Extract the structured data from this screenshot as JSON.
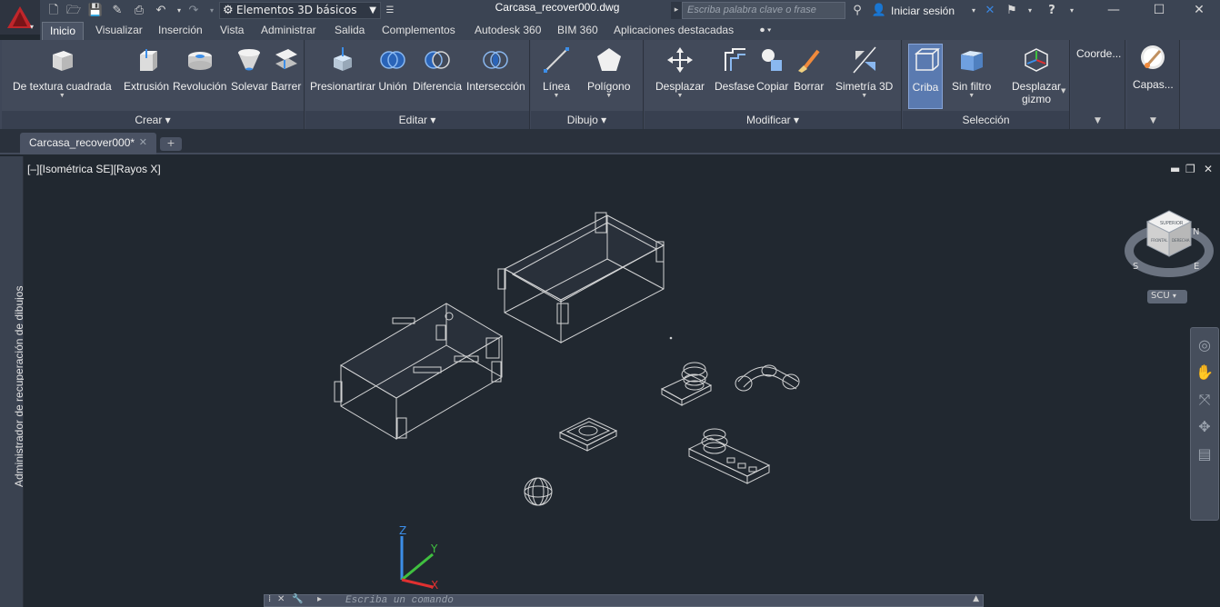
{
  "titlebar": {
    "workspace": "Elementos 3D básicos",
    "file_title": "Carcasa_recover000.dwg",
    "search_placeholder": "Escriba palabra clave o frase",
    "signin": "Iniciar sesión"
  },
  "tabs": [
    {
      "label": "Inicio",
      "active": true
    },
    {
      "label": "Visualizar"
    },
    {
      "label": "Inserción"
    },
    {
      "label": "Vista"
    },
    {
      "label": "Administrar"
    },
    {
      "label": "Salida"
    },
    {
      "label": "Complementos"
    },
    {
      "label": "Autodesk 360"
    },
    {
      "label": "BIM 360"
    },
    {
      "label": "Aplicaciones destacadas"
    }
  ],
  "panels": {
    "crear": {
      "title": "Crear",
      "tools": [
        "De textura cuadrada",
        "Extrusión",
        "Revolución",
        "Solevar",
        "Barrer"
      ]
    },
    "editar": {
      "title": "Editar",
      "tools": [
        "Presionartirar",
        "Unión",
        "Diferencia",
        "Intersección"
      ]
    },
    "dibujo": {
      "title": "Dibujo",
      "tools": [
        "Línea",
        "Polígono"
      ]
    },
    "modificar": {
      "title": "Modificar",
      "tools": [
        "Desplazar",
        "Desfase",
        "Copiar",
        "Borrar",
        "Simetría 3D"
      ]
    },
    "seleccion": {
      "title": "Selección",
      "tools": [
        "Criba",
        "Sin filtro",
        "Desplazar",
        "gizmo"
      ]
    },
    "coords": {
      "title": "Coorde..."
    },
    "capas": {
      "title": "Capas..."
    }
  },
  "filetab": {
    "label": "Carcasa_recover000*",
    "close": "✕",
    "new": "+"
  },
  "sidebar_label": "Administrador de recuperación de dibujos",
  "viewport": {
    "label": "[–][Isométrica SE][Rayos X]",
    "scu": "SCU"
  },
  "viewcube": {
    "top_face": "SUPERIOR",
    "front": "FRONTAL",
    "right": "DERECHA",
    "s": "S",
    "e": "E",
    "n": "N"
  },
  "ucs": {
    "x": "X",
    "y": "Y",
    "z": "Z"
  },
  "cmdline": {
    "placeholder": "Escriba un comando"
  },
  "colors": {
    "accent": "#5a7ab0",
    "background": "#212830",
    "ribbon": "#424a5a"
  }
}
